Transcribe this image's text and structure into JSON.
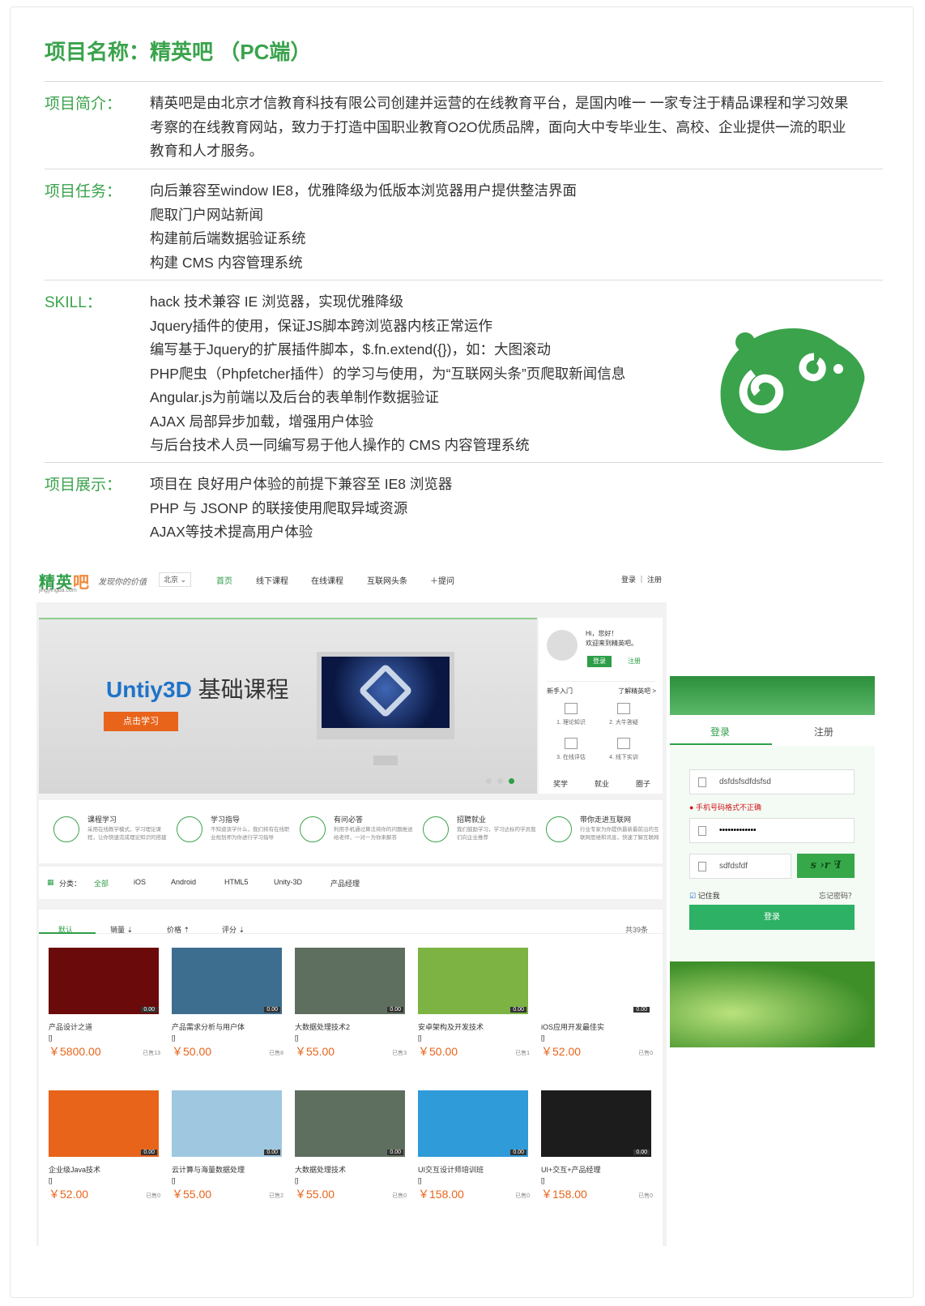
{
  "project_title": "项目名称：精英吧 （PC端）",
  "sections": [
    {
      "label": "项目简介：",
      "lines": [
        "精英吧是由北京才信教育科技有限公司创建并运营的在线教育平台，是国内唯一 一家专注于精品课程和学习效果",
        "考察的在线教育网站，致力于打造中国职业教育O2O优质品牌，面向大中专毕业生、高校、企业提供一流的职业",
        "教育和人才服务。"
      ]
    },
    {
      "label": "项目任务：",
      "lines": [
        "向后兼容至window IE8，优雅降级为低版本浏览器用户提供整洁界面",
        "爬取门户网站新闻",
        "构建前后端数据验证系统",
        "构建 CMS 内容管理系统"
      ]
    },
    {
      "label": "SKILL：",
      "lines": [
        "hack 技术兼容 IE 浏览器，实现优雅降级",
        "Jquery插件的使用，保证JS脚本跨浏览器内核正常运作",
        "编写基于Jquery的扩展插件脚本，$.fn.extend({})，如：大图滚动",
        "PHP爬虫（Phpfetcher插件）的学习与使用，为“互联网头条”页爬取新闻信息",
        "Angular.js为前端以及后台的表单制作数据验证",
        "AJAX 局部异步加载，增强用户体验",
        "与后台技术人员一同编写易于他人操作的 CMS 内容管理系统"
      ]
    },
    {
      "label": "项目展示：",
      "lines": [
        "项目在 良好用户体验的前提下兼容至 IE8 浏览器",
        "PHP 与 JSONP 的联接使用爬取异域资源",
        "AJAX等技术提高用户体验"
      ]
    }
  ],
  "site": {
    "brand": "精英",
    "brand_accent": "吧",
    "brand_sub": "jingyingba.com",
    "slogan": "发现你的价值",
    "city": "北京 ⌄",
    "nav": [
      "首页",
      "线下课程",
      "在线课程",
      "互联网头条",
      "＋提问"
    ],
    "login": "登录 ｜ 注册",
    "banner_title_en": "Untiy3D",
    "banner_title_cn": " 基础课程",
    "banner_button": "点击学习",
    "hi": "Hi，您好！",
    "welcome": "欢迎来到精英吧。",
    "side_login": "登录",
    "side_register": "注册",
    "newbie": "新手入门",
    "know_more": "了解精英吧 >",
    "steps": [
      "1. 理论知识",
      "2. 大牛答疑",
      "3. 在线评估",
      "4. 线下实训"
    ],
    "side_bottom": [
      "奖学",
      "就业",
      "圈子"
    ],
    "features": [
      {
        "title": "课程学习",
        "desc": "采用在线教学模式，学习理论课程，让你快速完成理论知识的搭建"
      },
      {
        "title": "学习指导",
        "desc": "不知道该学什么，我们将有在线职业规划师为你进行学习指导"
      },
      {
        "title": "有问必答",
        "desc": "利用手机通过算法将你的问题推送给老师，一对一为你来解答"
      },
      {
        "title": "招聘就业",
        "desc": "我们鼓励学习，学习达标的学员我们向企业推荐"
      },
      {
        "title": "带你走进互联网",
        "desc": "行业专家为你提供最新最前沿的互联网思维和讯息，快速了解互联网"
      }
    ],
    "categories_label": "分类：",
    "categories": [
      "全部",
      "iOS",
      "Android",
      "HTML5",
      "Unity-3D",
      "产品经理"
    ],
    "sort": [
      "默认",
      "销量 ⇣",
      "价格 ⇡",
      "评分 ⇣"
    ],
    "total": "共39条",
    "products": [
      {
        "name": "产品设计之道",
        "bracket": "[]",
        "price": "￥5800.00",
        "sold": "已售13",
        "badge": "0.00",
        "color": "#6b0a0a"
      },
      {
        "name": "产品需求分析与用户体",
        "bracket": "[]",
        "price": "￥50.00",
        "sold": "已售8",
        "badge": "0.00",
        "color": "#3e6e8f"
      },
      {
        "name": "大数据处理技术2",
        "bracket": "[]",
        "price": "￥55.00",
        "sold": "已售3",
        "badge": "0.00",
        "color": "#5f6f5f"
      },
      {
        "name": "安卓架构及开发技术",
        "bracket": "[]",
        "price": "￥50.00",
        "sold": "已售1",
        "badge": "0.00",
        "color": "#7cb342"
      },
      {
        "name": "iOS应用开发最佳实",
        "bracket": "[]",
        "price": "￥52.00",
        "sold": "已售0",
        "badge": "0.00",
        "color": "#ffffff"
      },
      {
        "name": "企业级Java技术",
        "bracket": "[]",
        "price": "￥52.00",
        "sold": "已售0",
        "badge": "0.00",
        "color": "#e8641b"
      },
      {
        "name": "云计算与海量数据处理",
        "bracket": "[]",
        "price": "￥55.00",
        "sold": "已售2",
        "badge": "0.00",
        "color": "#9fc7e0"
      },
      {
        "name": "大数据处理技术",
        "bracket": "[]",
        "price": "￥55.00",
        "sold": "已售0",
        "badge": "0.00",
        "color": "#5f6f5f"
      },
      {
        "name": "UI交互设计师培训班",
        "bracket": "[]",
        "price": "￥158.00",
        "sold": "已售0",
        "badge": "0.00",
        "color": "#2f9bd8"
      },
      {
        "name": "UI+交互+产品经理",
        "bracket": "[]",
        "price": "￥158.00",
        "sold": "已售0",
        "badge": "0.00",
        "color": "#1c1c1c"
      }
    ]
  },
  "login_panel": {
    "tab_login": "登录",
    "tab_register": "注册",
    "phone_value": "dsfdsfsdfdsfsd",
    "error": "手机号码格式不正确",
    "password_value": "•••••••••••••",
    "captcha_value": "sdfdsfdf",
    "captcha_image": "s ›r ꟻ",
    "remember": "记住我",
    "forgot": "忘记密码？",
    "submit": "登录"
  },
  "colors": {
    "green": "#3aa34c",
    "orange": "#e8641b"
  }
}
